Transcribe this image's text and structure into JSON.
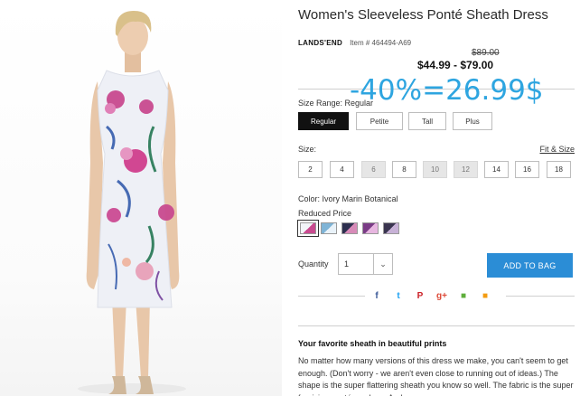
{
  "product": {
    "title": "Women's Sleeveless Ponté Sheath Dress",
    "brand": "LANDS'END",
    "item_number": "Item # 464494-A69",
    "original_price": "$89.00",
    "price_range": "$44.99 - $79.00"
  },
  "overlay_text": "-40%=26.99$",
  "size_range": {
    "label": "Size Range: Regular",
    "options": [
      "Regular",
      "Petite",
      "Tall",
      "Plus"
    ],
    "selected": "Regular"
  },
  "size": {
    "label": "Size:",
    "fit_link": "Fit & Size",
    "options": [
      {
        "value": "2",
        "available": true
      },
      {
        "value": "4",
        "available": true
      },
      {
        "value": "6",
        "available": false
      },
      {
        "value": "8",
        "available": true
      },
      {
        "value": "10",
        "available": false
      },
      {
        "value": "12",
        "available": false
      },
      {
        "value": "14",
        "available": true
      },
      {
        "value": "16",
        "available": true
      },
      {
        "value": "18",
        "available": true
      }
    ]
  },
  "color": {
    "label": "Color: Ivory Marin Botanical",
    "price_note": "Reduced Price",
    "swatches": [
      {
        "name": "Ivory Marin Botanical",
        "colors": [
          "#f2f4f8",
          "#c94a8f"
        ]
      },
      {
        "name": "Blue Botanical",
        "colors": [
          "#7fb4d6",
          "#e9f2f9"
        ]
      },
      {
        "name": "Navy Floral",
        "colors": [
          "#2d2f4f",
          "#d78ab8"
        ]
      },
      {
        "name": "Purple Floral",
        "colors": [
          "#7a3b86",
          "#e7b6e0"
        ]
      },
      {
        "name": "Dark Print",
        "colors": [
          "#3a3550",
          "#c7b1d6"
        ]
      }
    ]
  },
  "quantity": {
    "label": "Quantity",
    "value": "1"
  },
  "add_to_bag": "ADD TO BAG",
  "share": [
    {
      "name": "facebook-icon",
      "glyph": "f",
      "color": "#3b5998"
    },
    {
      "name": "twitter-icon",
      "glyph": "t",
      "color": "#1da1f2"
    },
    {
      "name": "pinterest-icon",
      "glyph": "P",
      "color": "#cb2027"
    },
    {
      "name": "google-plus-icon",
      "glyph": "g+",
      "color": "#dd4b39"
    },
    {
      "name": "gallery-icon",
      "glyph": "■",
      "color": "#5fae3c"
    },
    {
      "name": "save-icon",
      "glyph": "■",
      "color": "#f39c12"
    }
  ],
  "description": {
    "heading": "Your favorite sheath in beautiful prints",
    "body": "No matter how many versions of this dress we make, you can't seem to get enough. (Don't worry - we aren't even close to running out of ideas.) The shape is the super flattering sheath you know so well. The fabric is the super forgiving ponté you love. And"
  }
}
